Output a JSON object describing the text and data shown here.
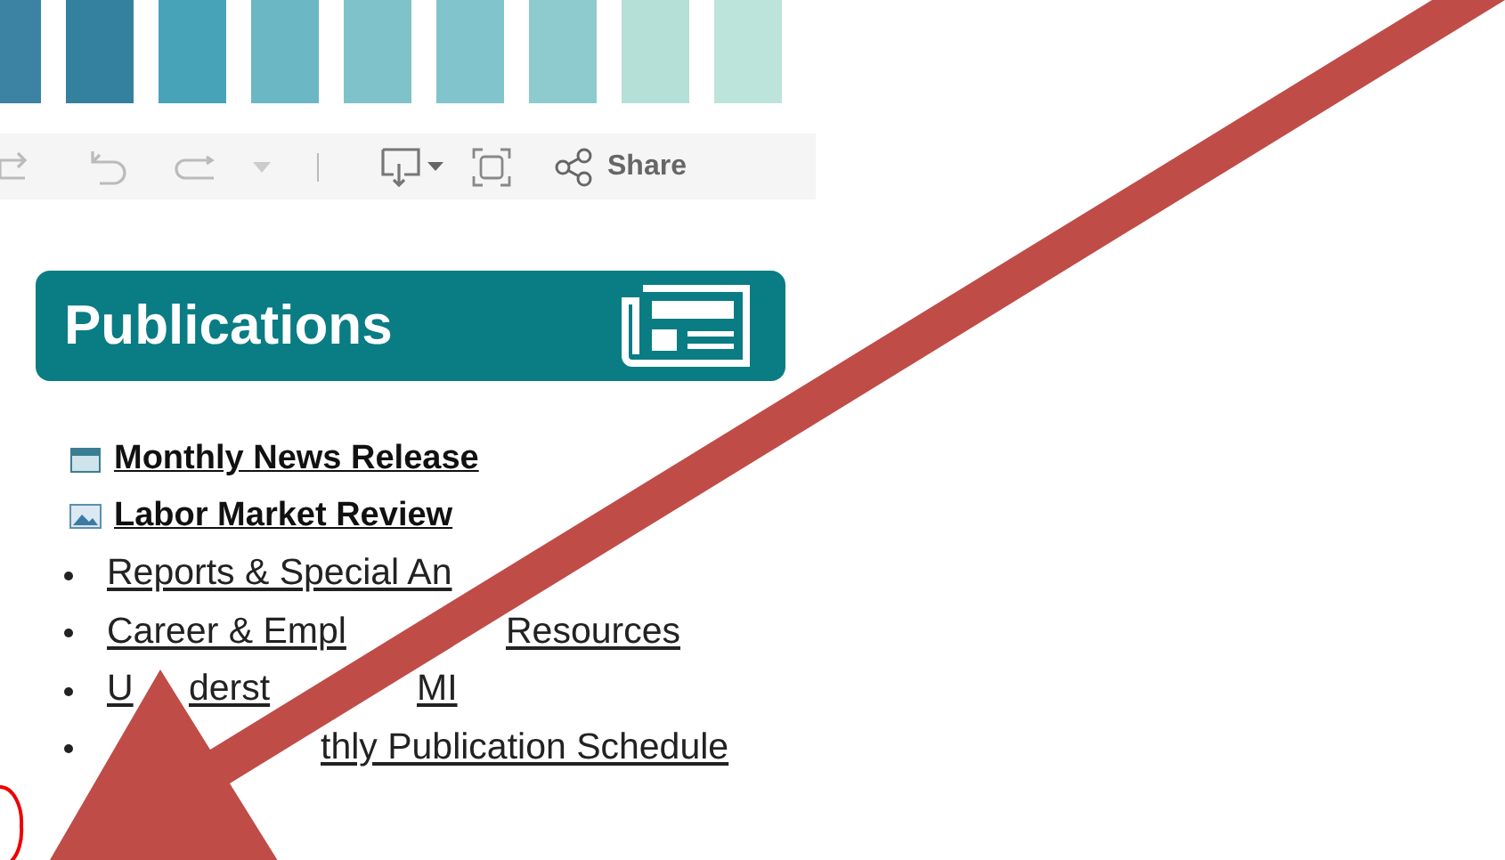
{
  "toolbar": {
    "share_label": "Share"
  },
  "publications": {
    "title": "Publications",
    "featured": [
      {
        "kind": "calendar",
        "text": "Monthly News Release"
      },
      {
        "kind": "chart",
        "text": "Labor Market Review"
      }
    ],
    "links": [
      {
        "parts": [
          "Reports & Special An"
        ]
      },
      {
        "parts": [
          "Career & Empl",
          "Resources"
        ]
      },
      {
        "parts": [
          "U",
          "derst",
          "MI"
        ]
      },
      {
        "parts": [
          "thly Publication Schedule"
        ]
      }
    ]
  }
}
